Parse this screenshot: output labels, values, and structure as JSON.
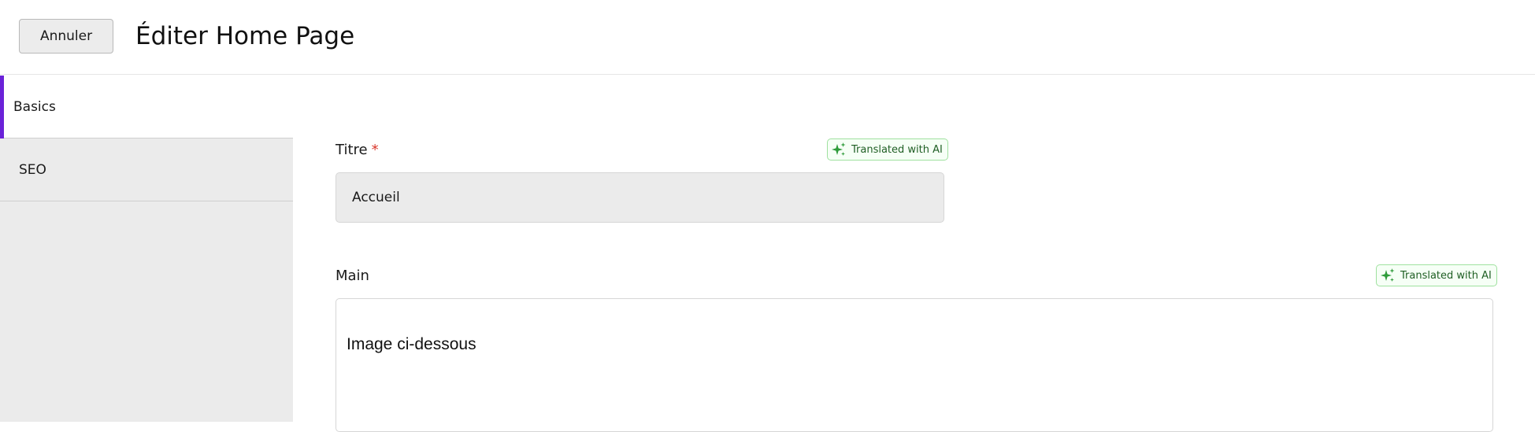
{
  "header": {
    "cancel_label": "Annuler",
    "title": "Éditer Home Page"
  },
  "sidebar": {
    "items": [
      {
        "label": "Basics",
        "active": true
      },
      {
        "label": "SEO",
        "active": false
      }
    ]
  },
  "form": {
    "title_field": {
      "label": "Titre",
      "required_mark": "*",
      "value": "Accueil",
      "badge": "Translated with AI"
    },
    "main_field": {
      "label": "Main",
      "content": "Image ci-dessous",
      "badge": "Translated with AI"
    }
  },
  "icons": {
    "ai_badge_icon": "sparkles-icon"
  },
  "colors": {
    "accent": "#6a22d8",
    "required": "#d9372b",
    "badge_border": "#9fe19f",
    "badge_icon": "#2e9b3a",
    "sidebar_bg": "#ebebeb"
  }
}
